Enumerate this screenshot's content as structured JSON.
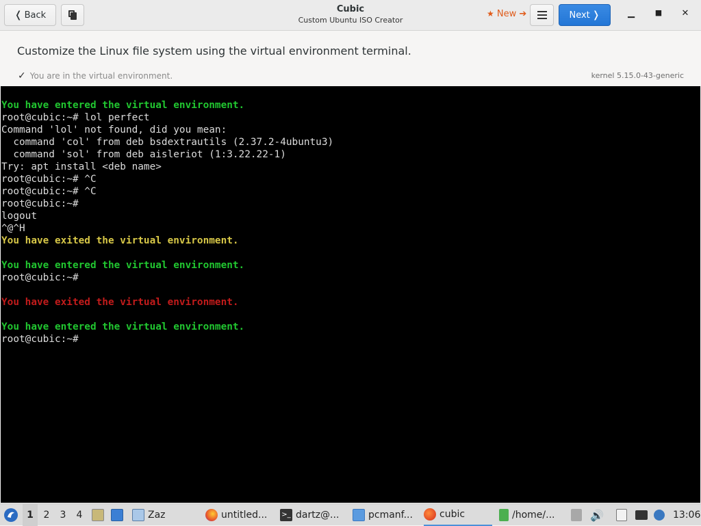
{
  "header": {
    "back_label": "Back",
    "title": "Cubic",
    "subtitle": "Custom Ubuntu ISO Creator",
    "new_label": "New",
    "next_label": "Next"
  },
  "info": {
    "heading": "Customize the Linux file system using the virtual environment terminal.",
    "status": "You are in the virtual environment.",
    "kernel": "kernel 5.15.0-43-generic"
  },
  "terminal": {
    "lines": [
      {
        "text": "You have entered the virtual environment.",
        "color": "green"
      },
      {
        "text": "root@cubic:~# lol perfect",
        "color": "white"
      },
      {
        "text": "Command 'lol' not found, did you mean:",
        "color": "white"
      },
      {
        "text": "  command 'col' from deb bsdextrautils (2.37.2-4ubuntu3)",
        "color": "white"
      },
      {
        "text": "  command 'sol' from deb aisleriot (1:3.22.22-1)",
        "color": "white"
      },
      {
        "text": "Try: apt install <deb name>",
        "color": "white"
      },
      {
        "text": "root@cubic:~# ^C",
        "color": "white"
      },
      {
        "text": "root@cubic:~# ^C",
        "color": "white"
      },
      {
        "text": "root@cubic:~#",
        "color": "white"
      },
      {
        "text": "logout",
        "color": "white"
      },
      {
        "text": "^@^H",
        "color": "white"
      },
      {
        "text": "You have exited the virtual environment.",
        "color": "yellow"
      },
      {
        "text": "",
        "color": "white"
      },
      {
        "text": "You have entered the virtual environment.",
        "color": "green"
      },
      {
        "text": "root@cubic:~#",
        "color": "white"
      },
      {
        "text": "",
        "color": "white"
      },
      {
        "text": "You have exited the virtual environment.",
        "color": "red"
      },
      {
        "text": "",
        "color": "white"
      },
      {
        "text": "You have entered the virtual environment.",
        "color": "green"
      },
      {
        "text": "root@cubic:~#",
        "color": "white"
      }
    ]
  },
  "taskbar": {
    "workspaces": [
      "1",
      "2",
      "3",
      "4"
    ],
    "active_workspace": "1",
    "tasks": [
      {
        "label": "Zaz",
        "icon": "window-icon"
      },
      {
        "label": "untitled...",
        "icon": "firefox-icon"
      },
      {
        "label": "dartz@...",
        "icon": "terminal-icon"
      },
      {
        "label": "pcmanf...",
        "icon": "folder-icon"
      },
      {
        "label": "cubic",
        "icon": "cubic-icon",
        "active": true
      },
      {
        "label": "/home/...",
        "icon": "file-icon"
      }
    ],
    "clock": "13:06"
  },
  "colors": {
    "accent": "#2376d6",
    "new_orange": "#e05b1a",
    "term_green": "#21c630",
    "term_yellow": "#d7c747",
    "term_red": "#c21b1b"
  }
}
